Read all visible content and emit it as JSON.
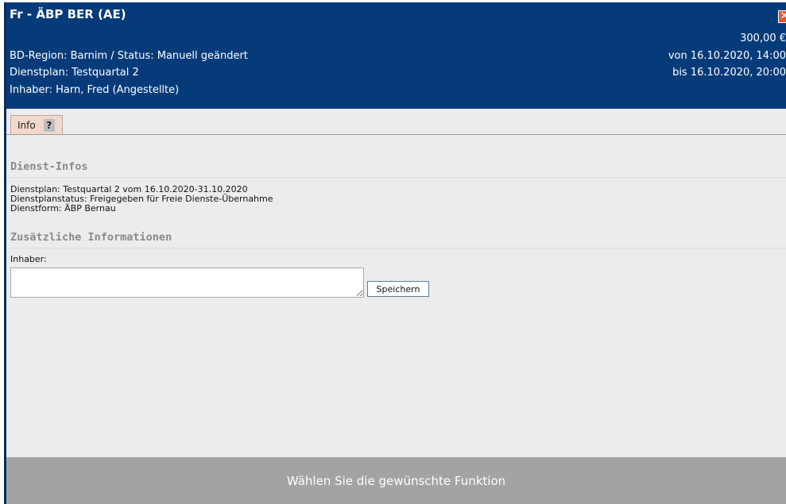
{
  "dialog": {
    "title": "Fr - ÄBP BER (AE)",
    "close_symbol": "✕",
    "amount": "300,00 €",
    "region_status": "BD-Region: Barnim / Status: Manuell geändert",
    "dienstplan": "Dienstplan: Testquartal 2",
    "inhaber": "Inhaber: Harn, Fred (Angestellte)",
    "von": "von 16.10.2020, 14:00",
    "bis": "bis 16.10.2020, 20:00"
  },
  "tabs": [
    {
      "label": "Info",
      "help": "?"
    }
  ],
  "dienst_infos": {
    "title": "Dienst-Infos",
    "lines": [
      "Dienstplan: Testquartal 2 vom 16.10.2020-31.10.2020",
      "Dienstplanstatus: Freigegeben für Freie Dienste-Übernahme",
      "Dienstform: ÄBP Bernau"
    ]
  },
  "zusatz": {
    "title": "Zusätzliche Informationen",
    "owner_label": "Inhaber:",
    "owner_value": "",
    "save_label": "Speichern"
  },
  "footer": {
    "text": "Wählen Sie die gewünschte Funktion"
  },
  "colors": {
    "header_bg": "#063b7a",
    "tab_bg": "#f3d8cc",
    "footer_bg": "#a3a3a3",
    "section_title": "#8a8a8a"
  }
}
